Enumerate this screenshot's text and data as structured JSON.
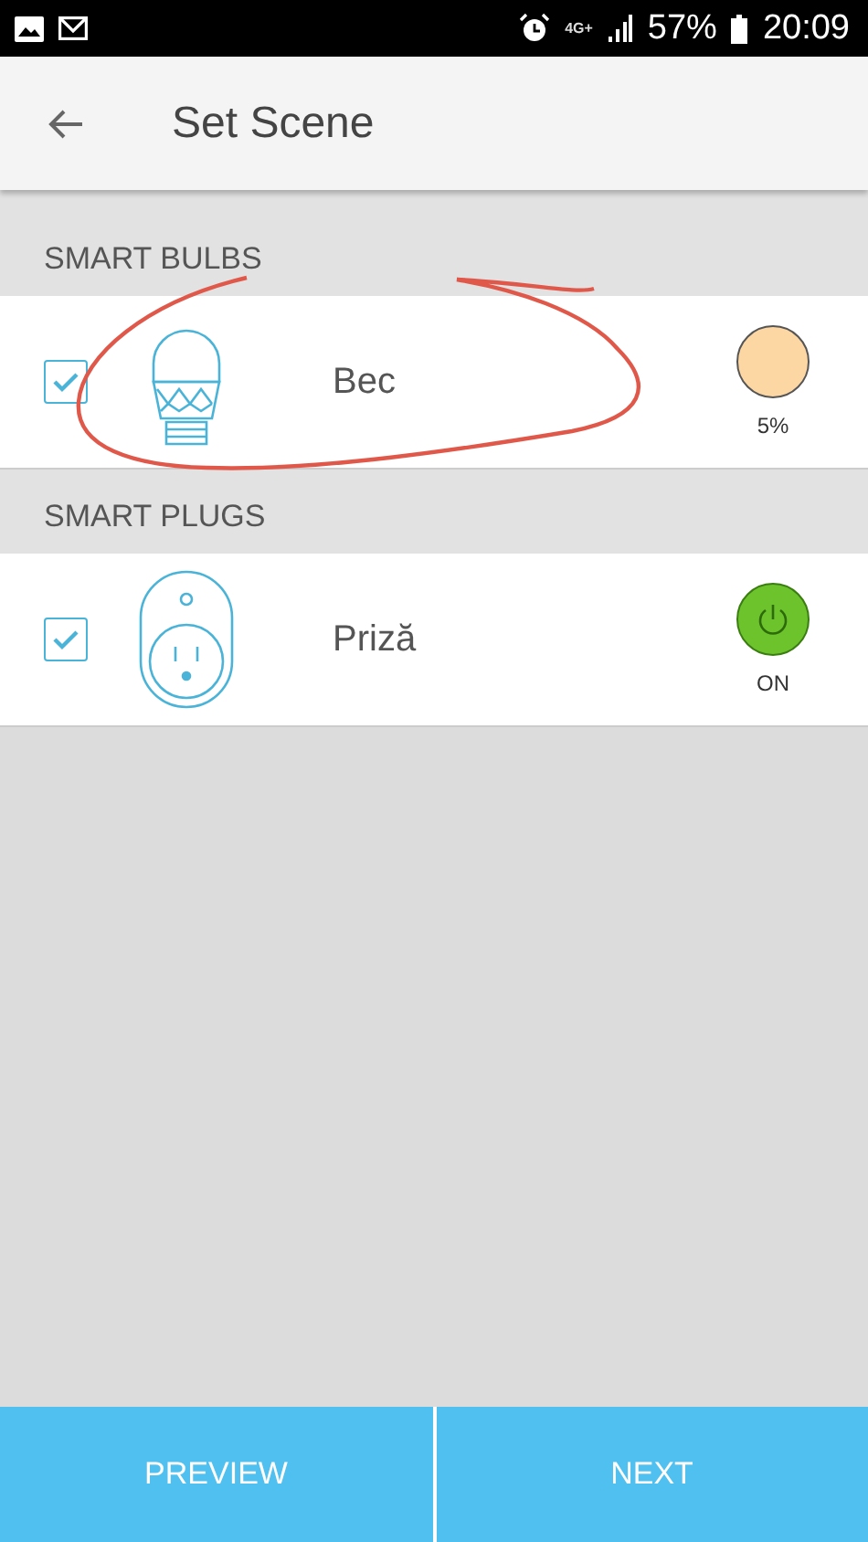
{
  "status_bar": {
    "network": "4G+",
    "battery": "57%",
    "time": "20:09"
  },
  "header": {
    "title": "Set Scene"
  },
  "sections": [
    {
      "title": "SMART BULBS",
      "devices": [
        {
          "kind": "bulb",
          "name": "Bec",
          "checked": true,
          "color": "#fdd7a3",
          "reading": "5%"
        }
      ]
    },
    {
      "title": "SMART PLUGS",
      "devices": [
        {
          "kind": "plug",
          "name": "Priză",
          "checked": true,
          "on": true,
          "reading": "ON"
        }
      ]
    }
  ],
  "buttons": [
    "PREVIEW",
    "NEXT"
  ]
}
